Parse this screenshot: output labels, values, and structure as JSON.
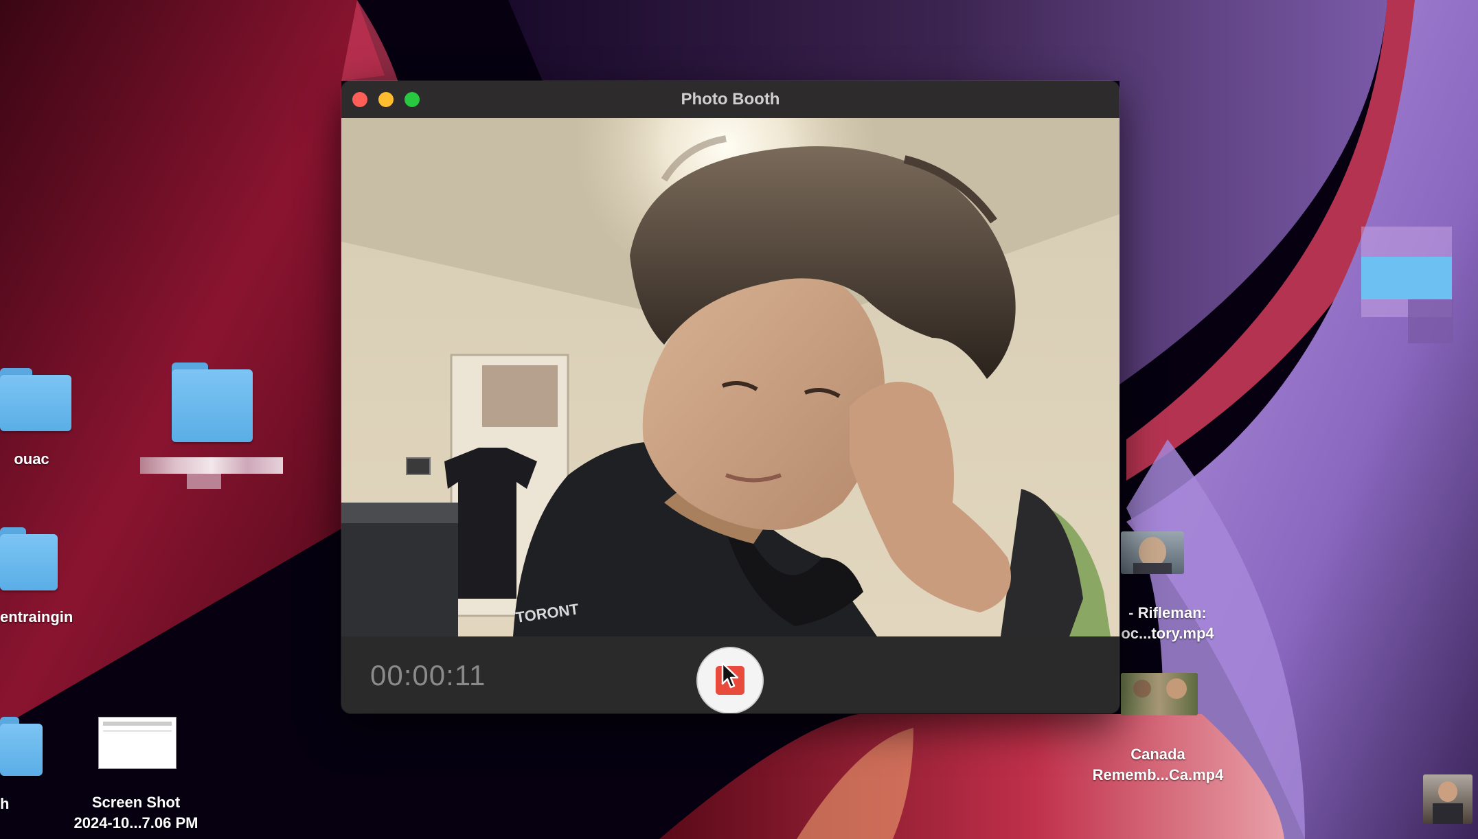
{
  "window": {
    "title": "Photo Booth",
    "timer": "00:00:11"
  },
  "desktop": {
    "items": [
      {
        "label": "ouac"
      },
      {
        "label": "entraingin"
      },
      {
        "label": "h"
      },
      {
        "label_line1": "Screen Shot",
        "label_line2": "2024-10...7.06 PM"
      },
      {
        "label_line1": "- Rifleman:",
        "label_line2": "oc...tory.mp4"
      },
      {
        "label_line1": "Canada",
        "label_line2": "Rememb...Ca.mp4"
      }
    ]
  },
  "colors": {
    "close": "#ff5f57",
    "minimize": "#febc2e",
    "maximize": "#28c840",
    "record": "#e84a3c"
  }
}
